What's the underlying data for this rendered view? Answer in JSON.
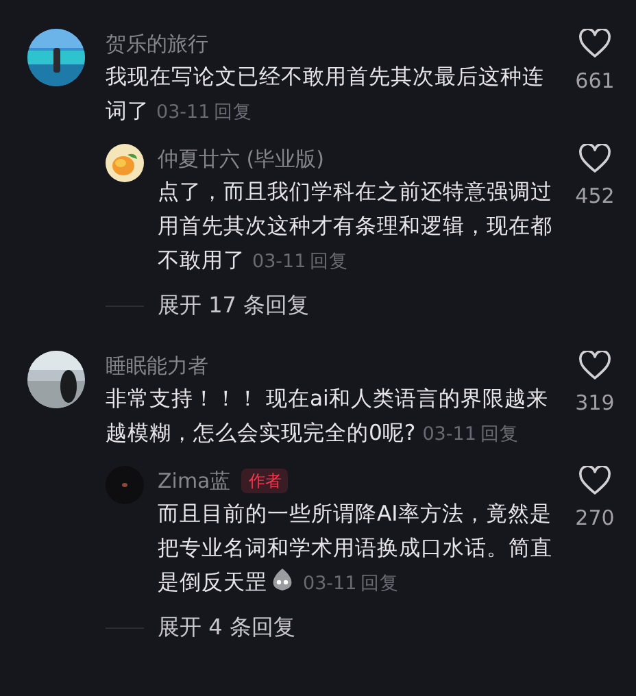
{
  "threads": [
    {
      "comment": {
        "name": "贺乐的旅行",
        "text": "我现在写论文已经不敢用首先其次最后这种连词了",
        "date": "03-11",
        "reply": "回复",
        "likes": "661"
      },
      "replies": [
        {
          "name": "仲夏廿六 (毕业版)",
          "text": "点了，而且我们学科在之前还特意强调过用首先其次这种才有条理和逻辑，现在都不敢用了",
          "date": "03-11",
          "reply": "回复",
          "likes": "452",
          "emoji": false
        }
      ],
      "expand": "展开 17 条回复"
    },
    {
      "comment": {
        "name": "睡眠能力者",
        "text": "非常支持！！！ 现在ai和人类语言的界限越来越模糊，怎么会实现完全的0呢?",
        "date": "03-11",
        "reply": "回复",
        "likes": "319"
      },
      "replies": [
        {
          "name": "Zima蓝",
          "badge": "作者",
          "text": "而且目前的一些所谓降AI率方法，竟然是把专业名词和学术用语换成口水话。简直是倒反天罡",
          "date": "03-11",
          "reply": "回复",
          "likes": "270",
          "emoji": true
        }
      ],
      "expand": "展开 4 条回复"
    }
  ]
}
